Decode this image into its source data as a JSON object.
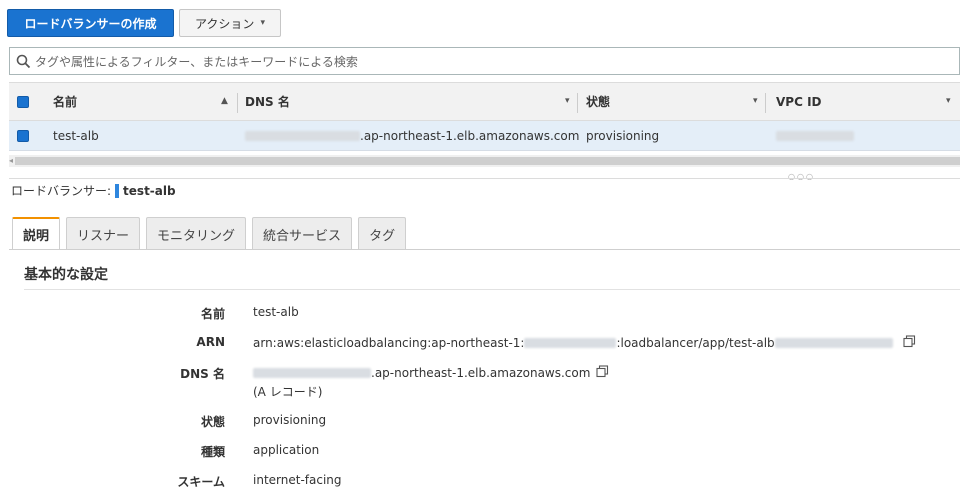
{
  "toolbar": {
    "create_label": "ロードバランサーの作成",
    "action_label": "アクション",
    "action_chevron": "▾"
  },
  "search": {
    "placeholder": "タグや属性によるフィルター、またはキーワードによる検索",
    "icon": "search-icon"
  },
  "table": {
    "columns": [
      {
        "label": "名前",
        "sort": "▲"
      },
      {
        "label": "DNS 名",
        "sort": "▾"
      },
      {
        "label": "状態",
        "sort": "▾"
      },
      {
        "label": "VPC ID",
        "sort": "▾"
      }
    ],
    "rows": [
      {
        "name": "test-alb",
        "dns_suffix": ".ap-northeast-1.elb.amazonaws.com",
        "state": "provisioning"
      }
    ]
  },
  "detail": {
    "prefix": "ロードバランサー:",
    "name": "test-alb",
    "tabs": [
      "説明",
      "リスナー",
      "モニタリング",
      "統合サービス",
      "タグ"
    ],
    "section_title": "基本的な設定",
    "fields": {
      "name_label": "名前",
      "name_value": "test-alb",
      "arn_label": "ARN",
      "arn_prefix": "arn:aws:elasticloadbalancing:ap-northeast-1:",
      "arn_middle": ":loadbalancer/app/test-alb",
      "dns_label": "DNS 名",
      "dns_value": ".ap-northeast-1.elb.amazonaws.com",
      "dns_note": "(A レコード)",
      "state_label": "状態",
      "state_value": "provisioning",
      "type_label": "種類",
      "type_value": "application",
      "scheme_label": "スキーム",
      "scheme_value": "internet-facing"
    }
  },
  "colors": {
    "primary": "#1a73d0",
    "selected_row": "#e4eef8",
    "active_tab": "#f29100"
  }
}
